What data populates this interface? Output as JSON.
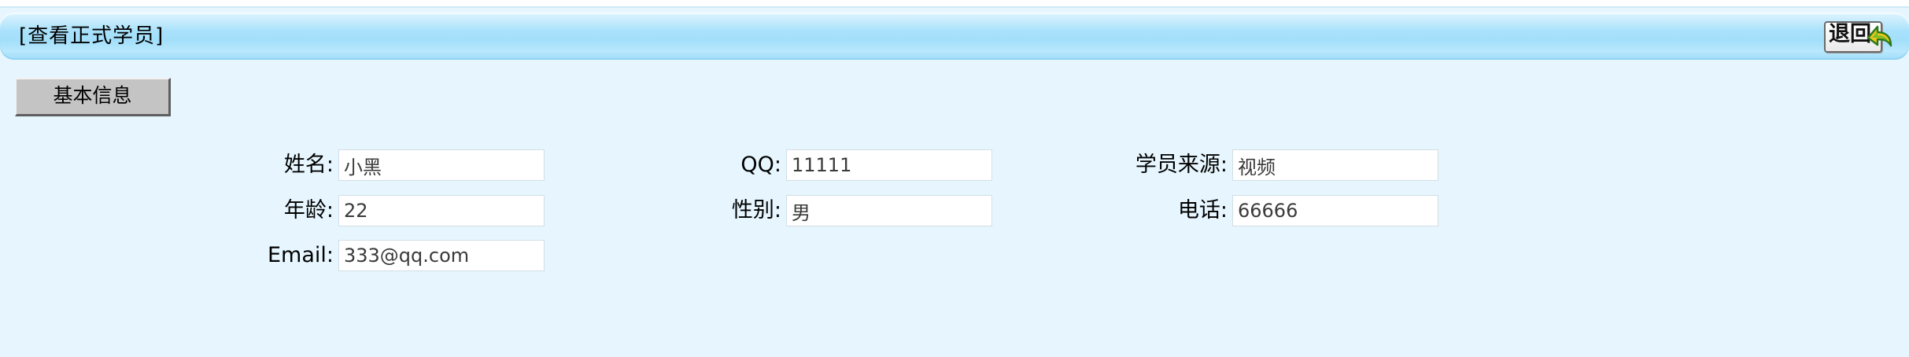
{
  "header": {
    "title": "[查看正式学员]",
    "back_label": "退回"
  },
  "tabs": [
    {
      "label": "基本信息"
    }
  ],
  "fields": {
    "name": {
      "label": "姓名:",
      "value": "小黑"
    },
    "qq": {
      "label": "QQ:",
      "value": "11111"
    },
    "source": {
      "label": "学员来源:",
      "value": "视频"
    },
    "age": {
      "label": "年龄:",
      "value": "22"
    },
    "gender": {
      "label": "性别:",
      "value": "男"
    },
    "phone": {
      "label": "电话:",
      "value": "66666"
    },
    "email": {
      "label": "Email:",
      "value": "333@qq.com"
    }
  },
  "colors": {
    "page_background": "#e7f6fe",
    "title_bar": "#a3dffa",
    "tab_button": "#c4c4c4"
  },
  "icons": {
    "back": "green-return-arrow-icon"
  }
}
